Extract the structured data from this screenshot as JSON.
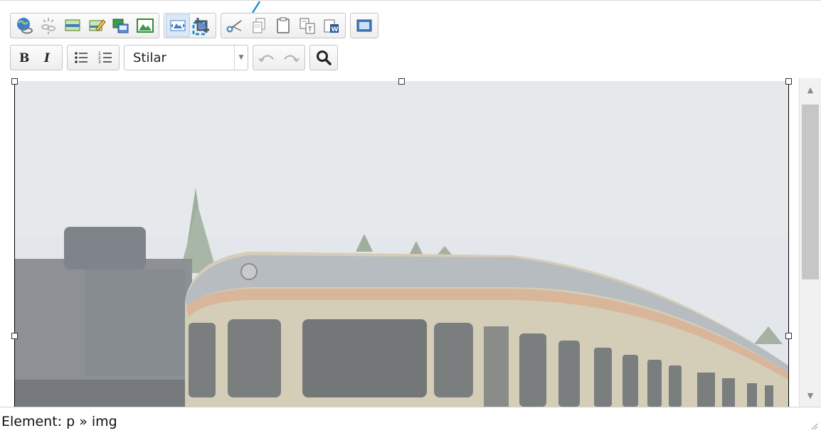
{
  "toolbar": {
    "style_dropdown": {
      "value": "Stilar"
    }
  },
  "content": {
    "image_selected": true
  },
  "status_bar": {
    "path_label": "Element: p » img"
  },
  "colors": {
    "accent": "#1a8fe0",
    "active_button": "#dbe8f7",
    "scroll_thumb": "#c6c6c6"
  }
}
